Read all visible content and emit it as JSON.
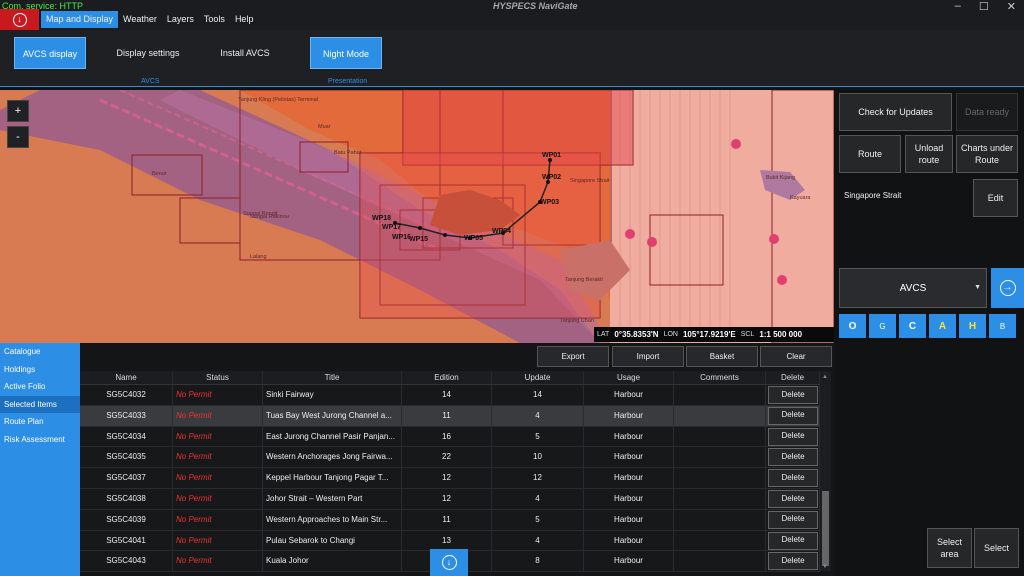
{
  "status": {
    "com_service": "Com. service: HTTP"
  },
  "app": {
    "title": "HYSPECS NaviGate"
  },
  "menu": [
    {
      "label": "Map and Display",
      "active": true
    },
    {
      "label": "Weather"
    },
    {
      "label": "Layers"
    },
    {
      "label": "Tools"
    },
    {
      "label": "Help"
    }
  ],
  "window_controls": {
    "minimize": "–",
    "maximize": "☐",
    "close": "✕"
  },
  "ribbon": {
    "avcs_display": "AVCS display",
    "display_settings": "Display settings",
    "install_avcs": "Install AVCS",
    "night_mode": "Night Mode",
    "group_avcs": "AVCS",
    "group_presentation": "Presentation"
  },
  "map": {
    "zoom_in": "+",
    "zoom_out": "-",
    "waypoints": [
      "WP01",
      "WP02",
      "WP03",
      "WP04",
      "WP05",
      "WP15",
      "WP16",
      "WP17",
      "WP18"
    ],
    "place_labels": [
      "Tanjung Kling (Pelintas) Terminal",
      "Muar",
      "Batu Pahat",
      "Benut",
      "Sungai Rengit",
      "Sungai Rakinnu",
      "Lalang",
      "Singapore Strait",
      "Tanjung Uban",
      "Bukit Kijang",
      "Kayuara",
      "Tanjung Berakit"
    ],
    "coords": {
      "lat_label": "LAT",
      "lat": "0°35.8353'N",
      "lon_label": "LON",
      "lon": "105°17.9219'E",
      "scl_label": "SCL",
      "scl": "1:1 500 000"
    }
  },
  "panel": {
    "check_updates": "Check for Updates",
    "data_ready": "Data ready",
    "route": "Route",
    "unload_route": "Unload route",
    "charts_under_route": "Charts under Route",
    "route_name": "Singapore Strait",
    "edit": "Edit",
    "avcs_select": "AVCS",
    "filters": [
      "O",
      "G",
      "C",
      "A",
      "H",
      "B"
    ],
    "select_area": "Select area",
    "select": "Select"
  },
  "nav": [
    {
      "label": "Catalogue"
    },
    {
      "label": "Holdings"
    },
    {
      "label": "Active Folio"
    },
    {
      "label": "Selected Items",
      "active": true
    },
    {
      "label": "Route Plan"
    },
    {
      "label": "Risk Assessment"
    }
  ],
  "toolbar": {
    "export": "Export",
    "import": "Import",
    "basket": "Basket",
    "clear": "Clear"
  },
  "table": {
    "columns": [
      "Name",
      "Status",
      "Title",
      "Edition",
      "Update",
      "Usage",
      "Comments",
      "Delete"
    ],
    "delete_label": "Delete",
    "rows": [
      {
        "name": "SG5C4032",
        "status": "No Permit",
        "title": "Sinki Fairway",
        "edition": "14",
        "update": "14",
        "usage": "Harbour",
        "comments": ""
      },
      {
        "name": "SG5C4033",
        "status": "No Permit",
        "title": "Tuas Bay West Jurong Channel a...",
        "edition": "11",
        "update": "4",
        "usage": "Harbour",
        "comments": ""
      },
      {
        "name": "SG5C4034",
        "status": "No Permit",
        "title": "East Jurong Channel Pasir Panjan...",
        "edition": "16",
        "update": "5",
        "usage": "Harbour",
        "comments": ""
      },
      {
        "name": "SG5C4035",
        "status": "No Permit",
        "title": "Western Anchorages Jong Fairwa...",
        "edition": "22",
        "update": "10",
        "usage": "Harbour",
        "comments": ""
      },
      {
        "name": "SG5C4037",
        "status": "No Permit",
        "title": "Keppel Harbour Tanjong Pagar T...",
        "edition": "12",
        "update": "12",
        "usage": "Harbour",
        "comments": ""
      },
      {
        "name": "SG5C4038",
        "status": "No Permit",
        "title": "Johor Strait – Western Part",
        "edition": "12",
        "update": "4",
        "usage": "Harbour",
        "comments": ""
      },
      {
        "name": "SG5C4039",
        "status": "No Permit",
        "title": "Western Approaches to Main Str...",
        "edition": "11",
        "update": "5",
        "usage": "Harbour",
        "comments": ""
      },
      {
        "name": "SG5C4041",
        "status": "No Permit",
        "title": "Pulau Sebarok to Changi",
        "edition": "13",
        "update": "4",
        "usage": "Harbour",
        "comments": ""
      },
      {
        "name": "SG5C4043",
        "status": "No Permit",
        "title": "Kuala Johor",
        "edition": "",
        "update": "8",
        "usage": "Harbour",
        "comments": ""
      }
    ]
  },
  "colors": {
    "accent": "#2d8ee6",
    "no_permit": "#e33333",
    "home": "#c8191e"
  }
}
